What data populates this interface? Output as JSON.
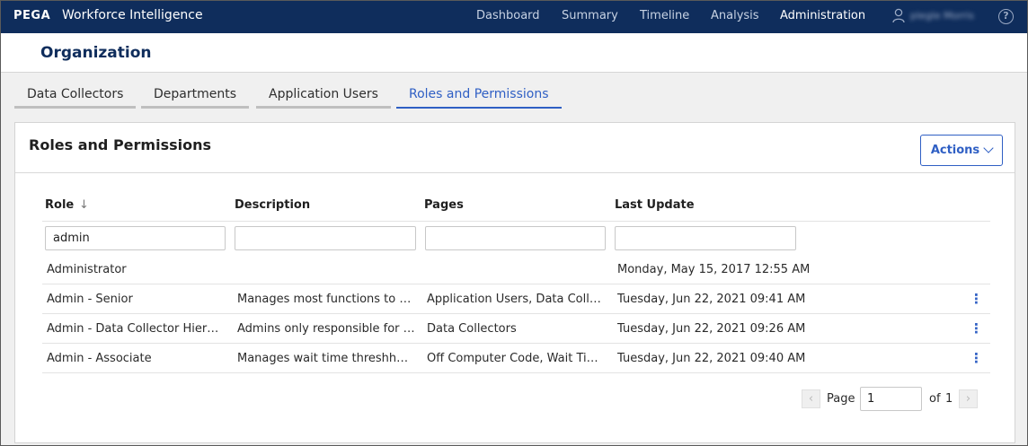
{
  "topbar": {
    "brand": "PEGA",
    "product": "Workforce Intelligence",
    "nav": [
      "Dashboard",
      "Summary",
      "Timeline",
      "Analysis",
      "Administration"
    ],
    "active_nav": "Administration",
    "user_name": "plegle Morris",
    "help_glyph": "?",
    "icons": {
      "user": "user-icon",
      "help": "help-icon"
    }
  },
  "page": {
    "title": "Organization"
  },
  "tabs": [
    "Data Collectors",
    "Departments",
    "Application Users",
    "Roles and Permissions"
  ],
  "active_tab": "Roles and Permissions",
  "card": {
    "title": "Roles and Permissions",
    "actions_label": "Actions"
  },
  "table": {
    "columns": [
      "Role",
      "Description",
      "Pages",
      "Last Update"
    ],
    "sort_column": "Role",
    "sort_direction": "descending",
    "filters": {
      "role": "admin",
      "description": "",
      "pages": "",
      "last_update": ""
    },
    "rows": [
      {
        "role": "Administrator",
        "description": "",
        "pages": "",
        "last_update": "Monday, May 15, 2017 12:55 AM",
        "has_menu": false
      },
      {
        "role": "Admin - Senior",
        "description": "Manages most functions to ba...",
        "pages": "Application Users, Data Collect...",
        "last_update": "Tuesday, Jun 22, 2021 09:41 AM",
        "has_menu": true
      },
      {
        "role": "Admin - Data Collector Hierarc...",
        "description": "Admins only responsible for d...",
        "pages": "Data Collectors",
        "last_update": "Tuesday, Jun 22, 2021 09:26 AM",
        "has_menu": true
      },
      {
        "role": "Admin - Associate",
        "description": "Manages wait time threshhold...",
        "pages": "Off Computer Code, Wait Time",
        "last_update": "Tuesday, Jun 22, 2021 09:40 AM",
        "has_menu": true
      }
    ]
  },
  "pager": {
    "page_label": "Page",
    "current_page": "1",
    "of_label": "of",
    "total_pages": "1"
  },
  "colors": {
    "topbar": "#0f2d5c",
    "accent": "#2f5fc4",
    "title": "#0f2d5c",
    "content_bg": "#f0f0f0"
  }
}
